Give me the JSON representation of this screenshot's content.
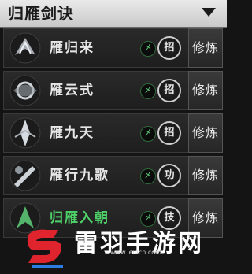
{
  "header": {
    "title": "归雁剑诀"
  },
  "skills": [
    {
      "name": "雁归来",
      "badge": "㐅",
      "seal": "招",
      "button": "修炼",
      "color": "#e6e6e6"
    },
    {
      "name": "雁云式",
      "badge": "㐅",
      "seal": "招",
      "button": "修炼",
      "color": "#e6e6e6"
    },
    {
      "name": "雁九天",
      "badge": "㐅",
      "seal": "招",
      "button": "修炼",
      "color": "#e6e6e6"
    },
    {
      "name": "雁行九歌",
      "badge": "㐅",
      "seal": "功",
      "button": "修炼",
      "color": "#e6e6e6"
    },
    {
      "name": "归雁入朝",
      "badge": "㐅",
      "seal": "技",
      "button": "修炼",
      "color": "#4fd16a"
    }
  ],
  "watermark": {
    "text": "雷羽手游网",
    "url": "www.leiucn.com"
  }
}
